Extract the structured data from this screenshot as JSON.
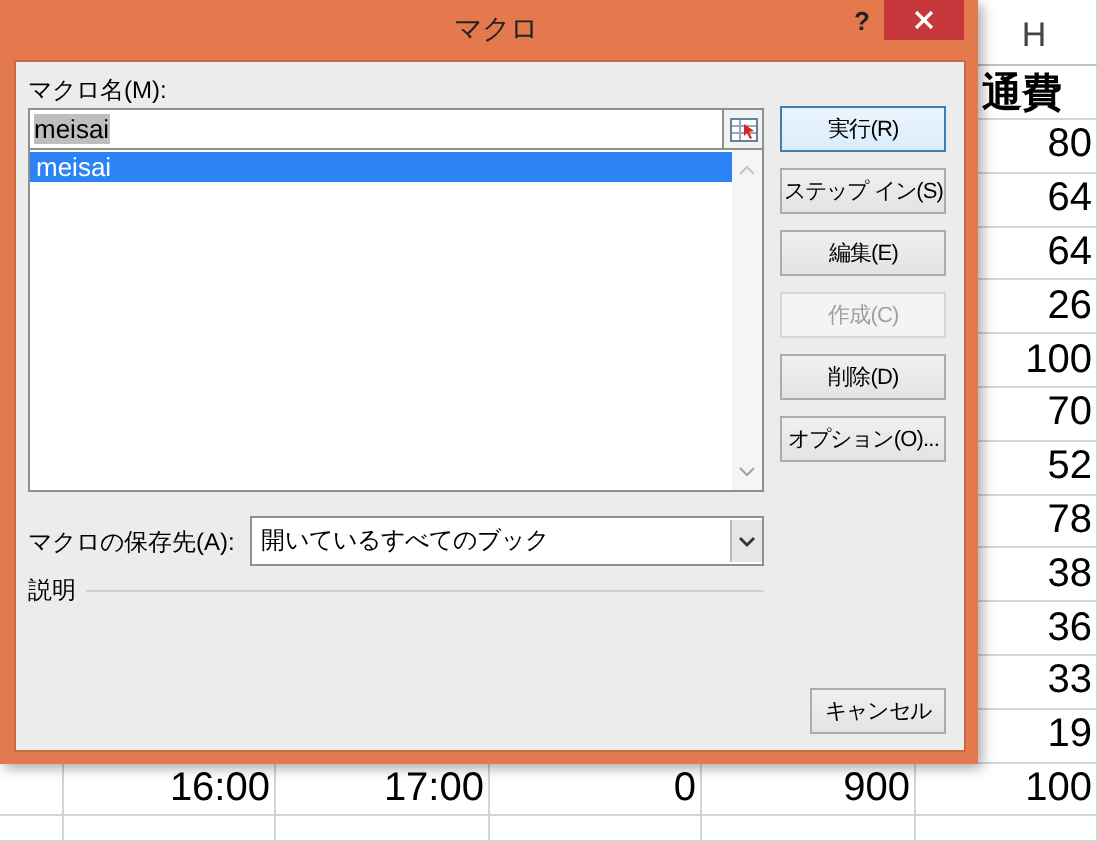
{
  "sheet": {
    "column_header": "H",
    "column_h_cells": [
      "通費",
      "80",
      "64",
      "64",
      "26",
      "100",
      "70",
      "52",
      "78",
      "38",
      "36",
      "33",
      "19"
    ],
    "bottom_row": [
      "16:00",
      "17:00",
      "0",
      "900",
      "100"
    ]
  },
  "window": {
    "title": "マクロ",
    "help": "?"
  },
  "macro_name": {
    "label": "マクロ名(M):",
    "value": "meisai"
  },
  "macros": [
    {
      "name": "meisai",
      "selected": true
    }
  ],
  "buttons": [
    {
      "label": "実行(R)",
      "disabled": false,
      "default": true
    },
    {
      "label": "ステップ イン(S)",
      "disabled": false,
      "default": false
    },
    {
      "label": "編集(E)",
      "disabled": false,
      "default": false
    },
    {
      "label": "作成(C)",
      "disabled": true,
      "default": false
    },
    {
      "label": "削除(D)",
      "disabled": false,
      "default": false
    },
    {
      "label": "オプション(O)...",
      "disabled": false,
      "default": false
    }
  ],
  "store_in": {
    "label": "マクロの保存先(A):",
    "value": "開いているすべてのブック"
  },
  "description": {
    "label": "説明"
  },
  "cancel": {
    "label": "キャンセル"
  }
}
